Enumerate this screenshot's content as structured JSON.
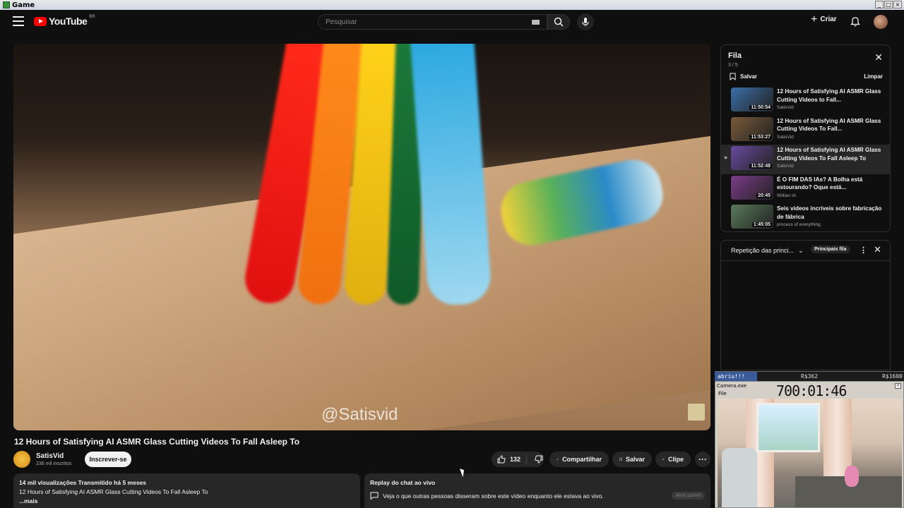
{
  "window": {
    "title": "Game"
  },
  "header": {
    "logo_text": "YouTube",
    "logo_country": "BR",
    "search_placeholder": "Pesquisar",
    "create_label": "Criar"
  },
  "video": {
    "watermark": "@Satisvid",
    "title": "12 Hours of Satisfying AI ASMR Glass Cutting Videos To Fall Asleep To",
    "channel": "SatisVid",
    "subscribers": "236 mil inscritos",
    "subscribe_label": "Inscrever-se",
    "like_count": "132",
    "share_label": "Compartilhar",
    "save_label": "Salvar",
    "clip_label": "Clipe"
  },
  "description": {
    "meta": "14 mil visualizações  Transmitido há 5 meses",
    "text": "12 Hours of Satisfying AI ASMR Glass Cutting Videos To Fall Asleep To",
    "more": "...mais"
  },
  "chat_replay": {
    "title": "Replay do chat ao vivo",
    "text": "Veja o que outras pessoas disseram sobre este vídeo enquanto ele estava ao vivo.",
    "open_label": "Abrir painel"
  },
  "queue": {
    "title": "Fila",
    "count": "3 / 5",
    "save_label": "Salvar",
    "clear_label": "Limpar",
    "items": [
      {
        "title": "12 Hours of Satisfying AI ASMR Glass Cutting Videos to Fall...",
        "channel": "SatisVid",
        "duration": "11:50:54",
        "color": "#3b6fa8"
      },
      {
        "title": "12 Hours of Satisfying AI ASMR Glass Cutting Videos To Fall...",
        "channel": "SatisVid",
        "duration": "11:53:27",
        "color": "#7a5a3a"
      },
      {
        "title": "12 Hours of Satisfying AI ASMR Glass Cutting Videos To Fall Asleep To",
        "channel": "SatisVid",
        "duration": "11:52:48",
        "color": "#6a4aa0"
      },
      {
        "title": "É O FIM DAS IAs? A Bolha está estourando? Oque está...",
        "channel": "Willian IA",
        "duration": "20:45",
        "color": "#7c3b8a"
      },
      {
        "title": "Seis vídeos incríveis sobre fabricação de fábrica",
        "channel": "process of everything",
        "duration": "1:45:05",
        "color": "#5a7a5a"
      }
    ],
    "active_index": 2
  },
  "chapters": {
    "label": "Repetição das princi...",
    "tag": "Principais fila"
  },
  "overlay": {
    "label": "abriu!!!",
    "value1": "R$362",
    "value2": "R$1600",
    "cam_title": "Camera.exe",
    "cam_menu": "File",
    "timer": "700:01:46"
  }
}
